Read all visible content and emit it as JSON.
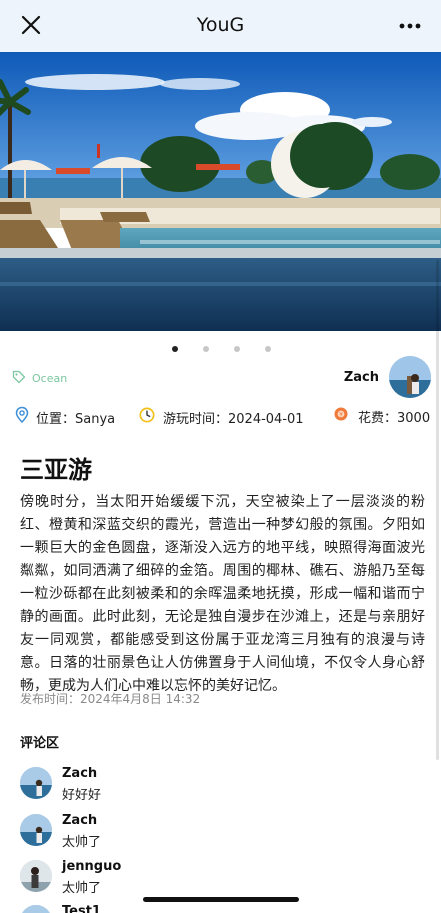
{
  "header": {
    "title": "YouG",
    "close_icon": "close-icon",
    "more_icon": "more-horizontal-icon"
  },
  "carousel": {
    "image_description_icon": "beach-pool-photo",
    "total_slides": 4,
    "active_slide": 1
  },
  "post": {
    "tag": "Ocean",
    "author": "Zach",
    "location_label": "位置：Sanya",
    "date_label": "游玩时间：2024-04-01",
    "cost_label": "花费：3000",
    "title": "三亚游",
    "body": "傍晚时分，当太阳开始缓缓下沉，天空被染上了一层淡淡的粉红、橙黄和深蓝交织的霞光，营造出一种梦幻般的氛围。夕阳如一颗巨大的金色圆盘，逐渐没入远方的地平线，映照得海面波光粼粼，如同洒满了细碎的金箔。周围的椰林、礁石、游船乃至每一粒沙砾都在此刻被柔和的余晖温柔地抚摸，形成一幅和谐而宁静的画面。此时此刻，无论是独自漫步在沙滩上，还是与亲朋好友一同观赏，都能感受到这份属于亚龙湾三月独有的浪漫与诗意。日落的壮丽景色让人仿佛置身于人间仙境，不仅令人身心舒畅，更成为人们心中难以忘怀的美好记忆。",
    "published": "发布时间：2024年4月8日 14:32"
  },
  "comments": {
    "heading": "评论区",
    "items": [
      {
        "name": "Zach",
        "text": "好好好"
      },
      {
        "name": "Zach",
        "text": "太帅了"
      },
      {
        "name": "jennguo",
        "text": "太帅了"
      },
      {
        "name": "Test1",
        "text": ""
      }
    ]
  },
  "colors": {
    "header_bg": "#eef4fb",
    "tag_green": "#7cc7a1",
    "location_blue": "#3d8fd8",
    "date_yellow": "#f2c018",
    "cost_orange": "#f07a3a"
  }
}
